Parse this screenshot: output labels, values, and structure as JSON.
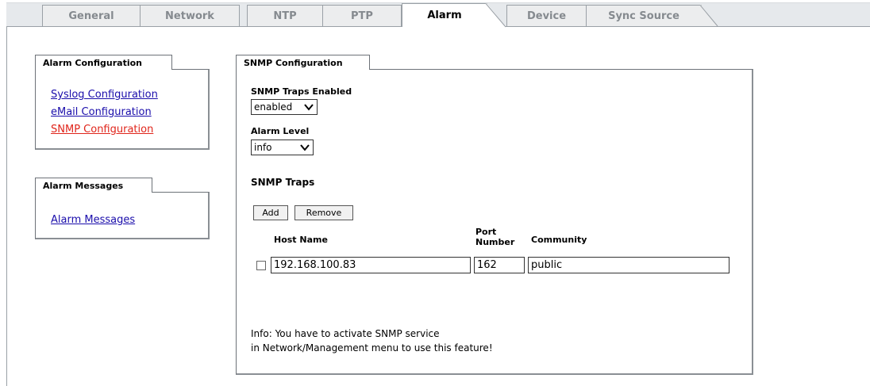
{
  "tabs": [
    {
      "label": "General"
    },
    {
      "label": "Network"
    },
    {
      "label": "NTP"
    },
    {
      "label": "PTP"
    },
    {
      "label": "Alarm",
      "active": true
    },
    {
      "label": "Device"
    },
    {
      "label": "Sync Source"
    }
  ],
  "alarm_config": {
    "title": "Alarm Configuration",
    "links": [
      "Syslog Configuration",
      "eMail Configuration",
      "SNMP Configuration"
    ],
    "current": "SNMP Configuration"
  },
  "alarm_messages": {
    "title": "Alarm Messages",
    "link": "Alarm Messages"
  },
  "snmp": {
    "title": "SNMP Configuration",
    "traps_enabled_label": "SNMP Traps Enabled",
    "traps_enabled_value": "enabled",
    "alarm_level_label": "Alarm Level",
    "alarm_level_value": "info",
    "traps_heading": "SNMP Traps",
    "add_label": "Add",
    "remove_label": "Remove",
    "columns": {
      "host": "Host Name",
      "port_line1": "Port",
      "port_line2": "Number",
      "community": "Community"
    },
    "rows": [
      {
        "checked": false,
        "host": "192.168.100.83",
        "port": "162",
        "community": "public"
      }
    ],
    "info_line1": "Info: You have to activate SNMP service",
    "info_line2": "in Network/Management menu to use this feature!"
  },
  "colors": {
    "link": "#1a0dab",
    "current_link": "#e0251b",
    "tab_inactive_text": "#858a8f",
    "tabstrip_bg": "#e6e9ec"
  }
}
